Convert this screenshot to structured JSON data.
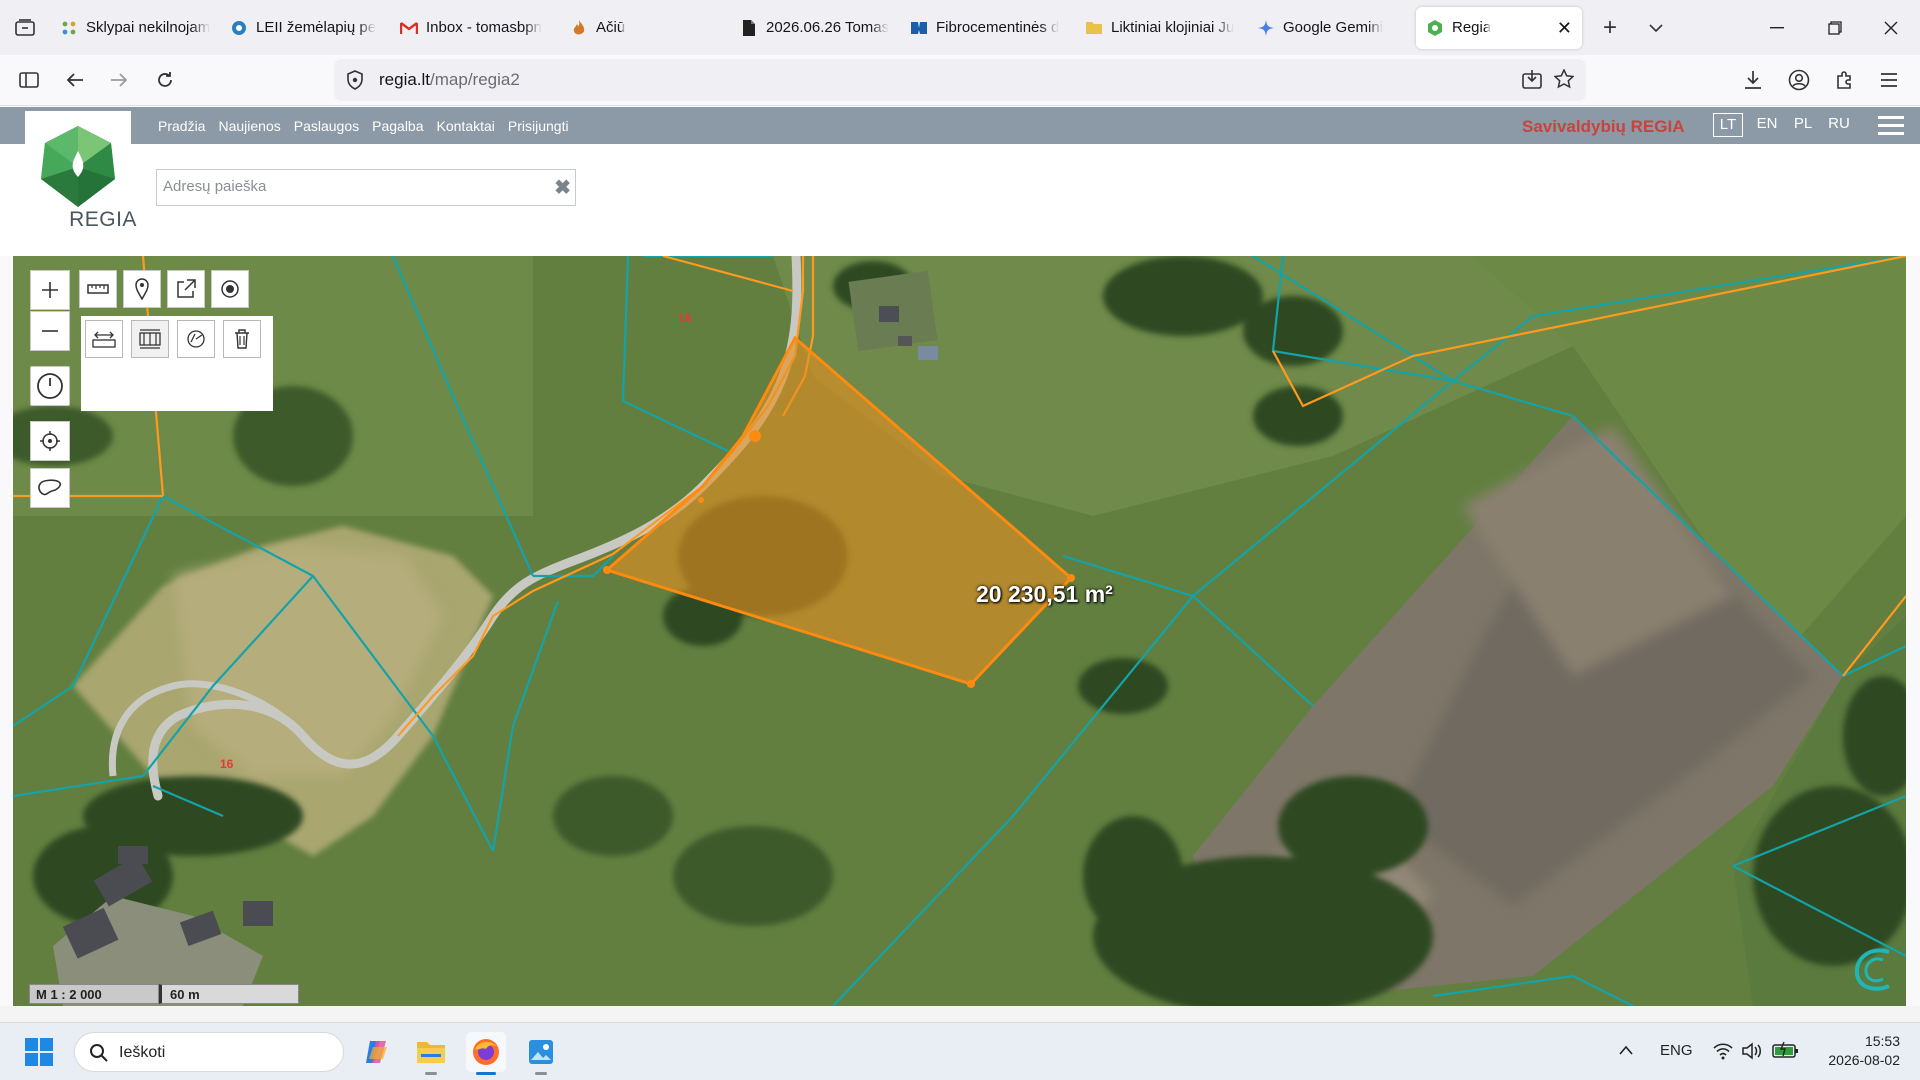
{
  "browser": {
    "tabs": [
      {
        "label": "Sklypai nekilnojam",
        "icon": "grid-icon",
        "color": "#6aa84f",
        "active": false
      },
      {
        "label": "LEII žemėlapių pe",
        "icon": "map-service-icon",
        "color": "#2a7fc1",
        "active": false
      },
      {
        "label": "Inbox - tomasbpn",
        "icon": "gmail-icon",
        "color": "#d93025",
        "active": false
      },
      {
        "label": "Ačiū",
        "icon": "flame-icon",
        "color": "#d07b2b",
        "active": false
      },
      {
        "label": "2026.06.26 Tomas",
        "icon": "pdf-file-icon",
        "color": "#222222",
        "active": false
      },
      {
        "label": "Fibrocementinės d",
        "icon": "bookmark-flag-icon",
        "color": "#1b5fa8",
        "active": false
      },
      {
        "label": "Liktiniai klojiniai Ju",
        "icon": "folder-icon",
        "color": "#e8c24a",
        "active": false
      },
      {
        "label": "Google Gemini",
        "icon": "gemini-icon",
        "color": "#4a7ee8",
        "active": false
      },
      {
        "label": "Regia",
        "icon": "regia-icon",
        "color": "#4caf50",
        "active": true
      }
    ],
    "tab_close": "✕",
    "new_tab": "+",
    "url_host": "regia.lt",
    "url_path": "/map/regia2"
  },
  "regia": {
    "menu": [
      "Pradžia",
      "Naujienos",
      "Paslaugos",
      "Pagalba",
      "Kontaktai",
      "Prisijungti"
    ],
    "brand": "Savivaldybių REGIA",
    "languages": [
      "LT",
      "EN",
      "PL",
      "RU"
    ],
    "selected_language": "LT",
    "logo_text": "REGIA",
    "search": {
      "placeholder": "Adresų paieška",
      "value": "",
      "clear": "✖"
    }
  },
  "map": {
    "area_label": "20 230,51 m²",
    "scale_ratio": "M 1 : 2 000",
    "scale_distance": "60 m",
    "parcel_color": "#ff9a1f",
    "boundary_color": "#14a3a8",
    "house_number_1": "18",
    "house_number_2": "16"
  },
  "taskbar": {
    "search_label": "Ieškoti",
    "language": "ENG",
    "time": "15:53",
    "date": "2026-08-02"
  }
}
